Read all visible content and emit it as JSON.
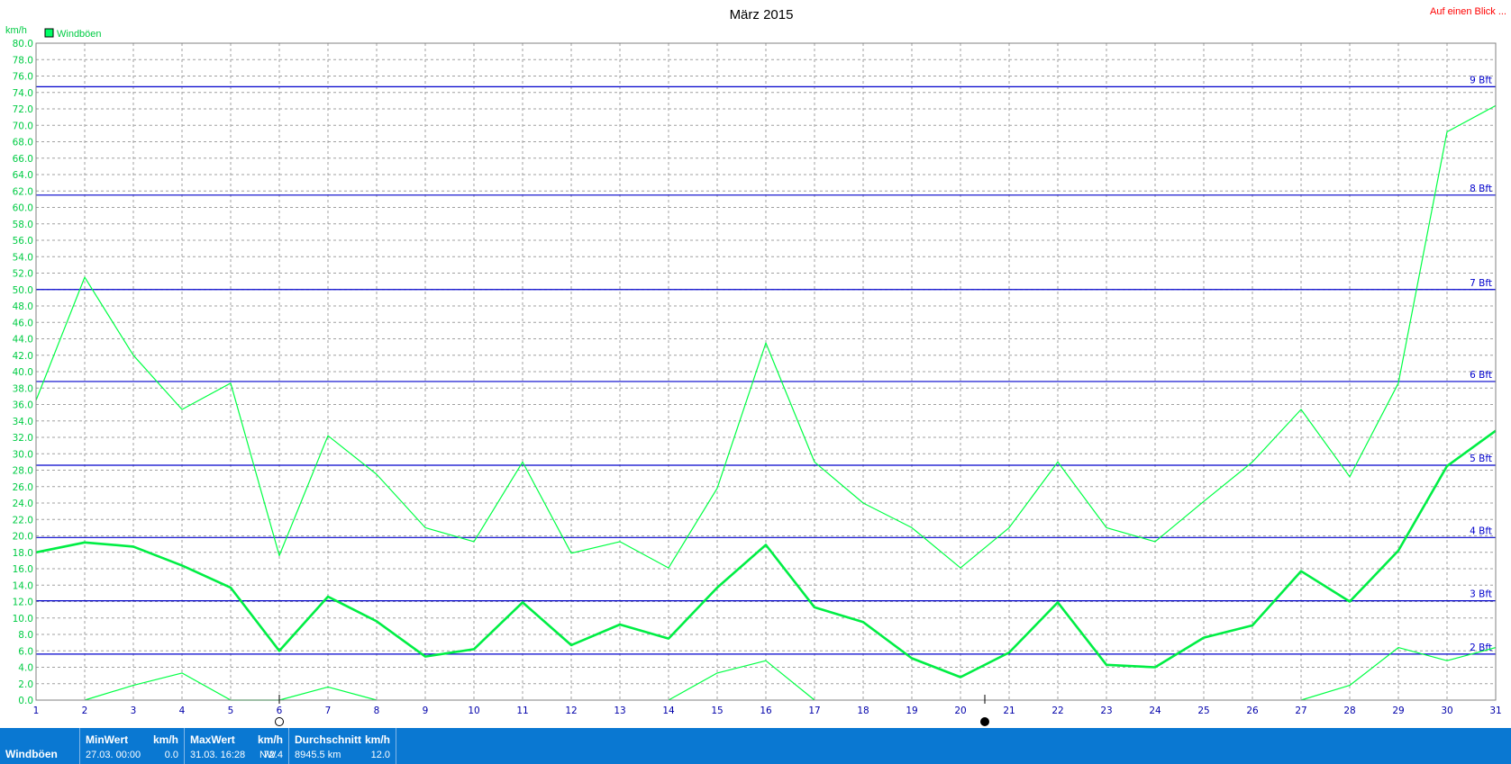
{
  "header": {
    "title": "März 2015",
    "link": "Auf einen Blick ..."
  },
  "chart_data": {
    "type": "line",
    "title": "März 2015",
    "ylabel": "km/h",
    "ylim": [
      0,
      80
    ],
    "yticks": [
      "0.0",
      "2.0",
      "4.0",
      "6.0",
      "8.0",
      "10.0",
      "12.0",
      "14.0",
      "16.0",
      "18.0",
      "20.0",
      "22.0",
      "24.0",
      "26.0",
      "28.0",
      "30.0",
      "32.0",
      "34.0",
      "36.0",
      "38.0",
      "40.0",
      "42.0",
      "44.0",
      "46.0",
      "48.0",
      "50.0",
      "52.0",
      "54.0",
      "56.0",
      "58.0",
      "60.0",
      "62.0",
      "64.0",
      "66.0",
      "68.0",
      "70.0",
      "72.0",
      "74.0",
      "76.0",
      "78.0",
      "80.0"
    ],
    "x": [
      1,
      2,
      3,
      4,
      5,
      6,
      7,
      8,
      9,
      10,
      11,
      12,
      13,
      14,
      15,
      16,
      17,
      18,
      19,
      20,
      21,
      22,
      23,
      24,
      25,
      26,
      27,
      28,
      29,
      30,
      31
    ],
    "grid": true,
    "legend": {
      "position": "top-left",
      "entries": [
        {
          "name": "Windböen",
          "color": "#00ff66"
        }
      ]
    },
    "series": [
      {
        "name": "Windböen",
        "role": "average",
        "color": "#00ee44",
        "values": [
          18.0,
          19.2,
          18.7,
          16.4,
          13.7,
          6.0,
          12.6,
          9.6,
          5.3,
          6.2,
          11.9,
          6.7,
          9.2,
          7.5,
          13.7,
          18.9,
          11.3,
          9.5,
          5.1,
          2.8,
          5.8,
          11.9,
          4.3,
          4.0,
          7.6,
          9.1,
          15.7,
          12.0,
          18.2,
          28.5,
          32.8
        ]
      },
      {
        "role": "maximum",
        "color": "#00ff44",
        "values": [
          36.5,
          51.5,
          42.0,
          35.4,
          38.6,
          17.6,
          32.2,
          27.5,
          21.0,
          19.3,
          29.0,
          17.9,
          19.3,
          16.1,
          25.8,
          43.5,
          29.0,
          24.0,
          21.0,
          16.1,
          21.0,
          29.0,
          21.0,
          19.3,
          24.2,
          29.0,
          35.4,
          27.2,
          38.6,
          69.2,
          72.4
        ]
      },
      {
        "role": "minimum",
        "color": "#00ff44",
        "values": [
          null,
          0.0,
          1.8,
          3.3,
          0.0,
          0.0,
          1.6,
          0.0,
          null,
          null,
          null,
          null,
          null,
          0.0,
          3.3,
          4.8,
          0.0,
          null,
          null,
          null,
          null,
          null,
          null,
          null,
          null,
          null,
          0.0,
          1.8,
          6.4,
          4.8,
          6.4
        ]
      }
    ],
    "reference_lines": [
      {
        "label": "2 Bft",
        "value": 5.6
      },
      {
        "label": "3 Bft",
        "value": 12.1
      },
      {
        "label": "4 Bft",
        "value": 19.8
      },
      {
        "label": "5 Bft",
        "value": 28.6
      },
      {
        "label": "6 Bft",
        "value": 38.8
      },
      {
        "label": "7 Bft",
        "value": 50.0
      },
      {
        "label": "8 Bft",
        "value": 61.5
      },
      {
        "label": "9 Bft",
        "value": 74.7
      }
    ],
    "moon_phases": [
      {
        "day": 6,
        "icon": "full-moon-icon"
      },
      {
        "day": 20.5,
        "icon": "new-moon-icon"
      }
    ]
  },
  "colors": {
    "axis_text": "#00cc44",
    "grid": "#a0a0a0",
    "beaufort": "#0000cc",
    "title": "#000000",
    "link": "#ff0000",
    "statusbar": "#0a78d2"
  },
  "statusbar": {
    "name": "Windböen",
    "min": {
      "label": "MinWert",
      "unit": "km/h",
      "when": "27.03.  00:00",
      "value": "0.0"
    },
    "max": {
      "label": "MaxWert",
      "unit": "km/h",
      "when": "31.03.  16:28",
      "dir": "NW",
      "value": "72.4"
    },
    "avg": {
      "label": "Durchschnitt",
      "unit": "km/h",
      "distance": "8945.5 km",
      "value": "12.0"
    }
  }
}
